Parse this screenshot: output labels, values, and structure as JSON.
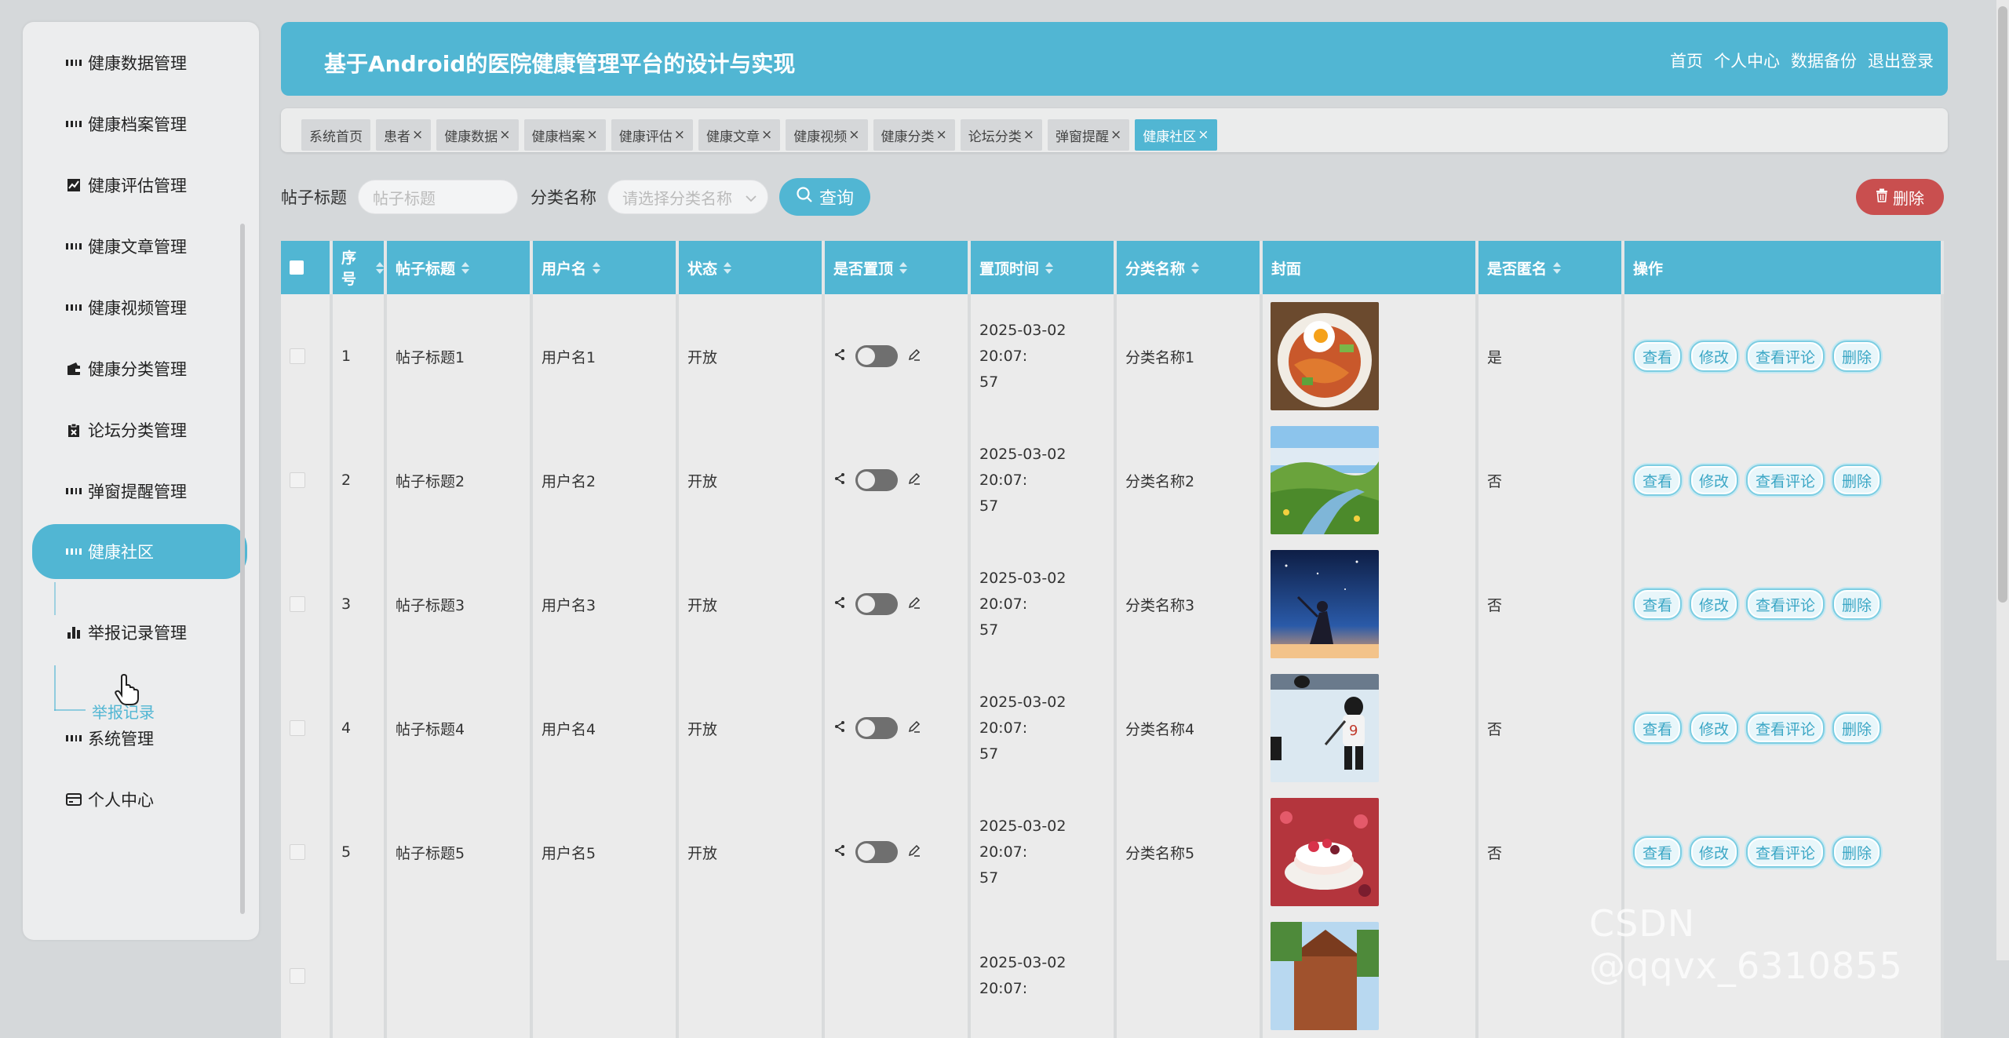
{
  "sidebar": {
    "items": [
      {
        "label": "健康数据管理",
        "icon": "grid-icon"
      },
      {
        "label": "健康档案管理",
        "icon": "grid-icon"
      },
      {
        "label": "健康评估管理",
        "icon": "chart-line-icon"
      },
      {
        "label": "健康文章管理",
        "icon": "grid-icon"
      },
      {
        "label": "健康视频管理",
        "icon": "grid-icon"
      },
      {
        "label": "健康分类管理",
        "icon": "wallet-icon"
      },
      {
        "label": "论坛分类管理",
        "icon": "clipboard-icon"
      },
      {
        "label": "弹窗提醒管理",
        "icon": "grid-icon"
      },
      {
        "label": "健康社区",
        "icon": "grid-icon",
        "active": true
      },
      {
        "label": "举报记录管理",
        "icon": "bar-chart-icon"
      },
      {
        "label": "系统管理",
        "icon": "grid-icon"
      },
      {
        "label": "个人中心",
        "icon": "card-icon"
      }
    ],
    "sub_item": "举报记录"
  },
  "header": {
    "title": "基于Android的医院健康管理平台的设计与实现",
    "nav": [
      "首页",
      "个人中心",
      "数据备份",
      "退出登录"
    ]
  },
  "tabs": [
    {
      "label": "系统首页",
      "closable": false
    },
    {
      "label": "患者",
      "closable": true
    },
    {
      "label": "健康数据",
      "closable": true
    },
    {
      "label": "健康档案",
      "closable": true
    },
    {
      "label": "健康评估",
      "closable": true
    },
    {
      "label": "健康文章",
      "closable": true
    },
    {
      "label": "健康视频",
      "closable": true
    },
    {
      "label": "健康分类",
      "closable": true
    },
    {
      "label": "论坛分类",
      "closable": true
    },
    {
      "label": "弹窗提醒",
      "closable": true
    },
    {
      "label": "健康社区",
      "closable": true,
      "active": true
    }
  ],
  "search": {
    "title_label": "帖子标题",
    "title_placeholder": "帖子标题",
    "category_label": "分类名称",
    "category_placeholder": "请选择分类名称",
    "query_button": "查询",
    "delete_button": "删除"
  },
  "table": {
    "columns": [
      "",
      "序号",
      "帖子标题",
      "用户名",
      "状态",
      "是否置顶",
      "置顶时间",
      "分类名称",
      "封面",
      "是否匿名",
      "操作"
    ],
    "actions": [
      "查看",
      "修改",
      "查看评论",
      "删除"
    ],
    "rows": [
      {
        "index": "1",
        "title": "帖子标题1",
        "user": "用户名1",
        "status": "开放",
        "time1": "2025-03-02 20:07:",
        "time2": "57",
        "category": "分类名称1",
        "anon": "是"
      },
      {
        "index": "2",
        "title": "帖子标题2",
        "user": "用户名2",
        "status": "开放",
        "time1": "2025-03-02 20:07:",
        "time2": "57",
        "category": "分类名称2",
        "anon": "否"
      },
      {
        "index": "3",
        "title": "帖子标题3",
        "user": "用户名3",
        "status": "开放",
        "time1": "2025-03-02 20:07:",
        "time2": "57",
        "category": "分类名称3",
        "anon": "否"
      },
      {
        "index": "4",
        "title": "帖子标题4",
        "user": "用户名4",
        "status": "开放",
        "time1": "2025-03-02 20:07:",
        "time2": "57",
        "category": "分类名称4",
        "anon": "否"
      },
      {
        "index": "5",
        "title": "帖子标题5",
        "user": "用户名5",
        "status": "开放",
        "time1": "2025-03-02 20:07:",
        "time2": "57",
        "category": "分类名称5",
        "anon": "否"
      },
      {
        "index": "",
        "title": "",
        "user": "",
        "status": "",
        "time1": "2025-03-02 20:07:",
        "time2": "",
        "category": "",
        "anon": ""
      }
    ]
  },
  "watermark": "CSDN @qqvx_6310855",
  "colors": {
    "accent": "#51b6d3",
    "danger": "#c94f4f",
    "background": "#d5d8da"
  }
}
